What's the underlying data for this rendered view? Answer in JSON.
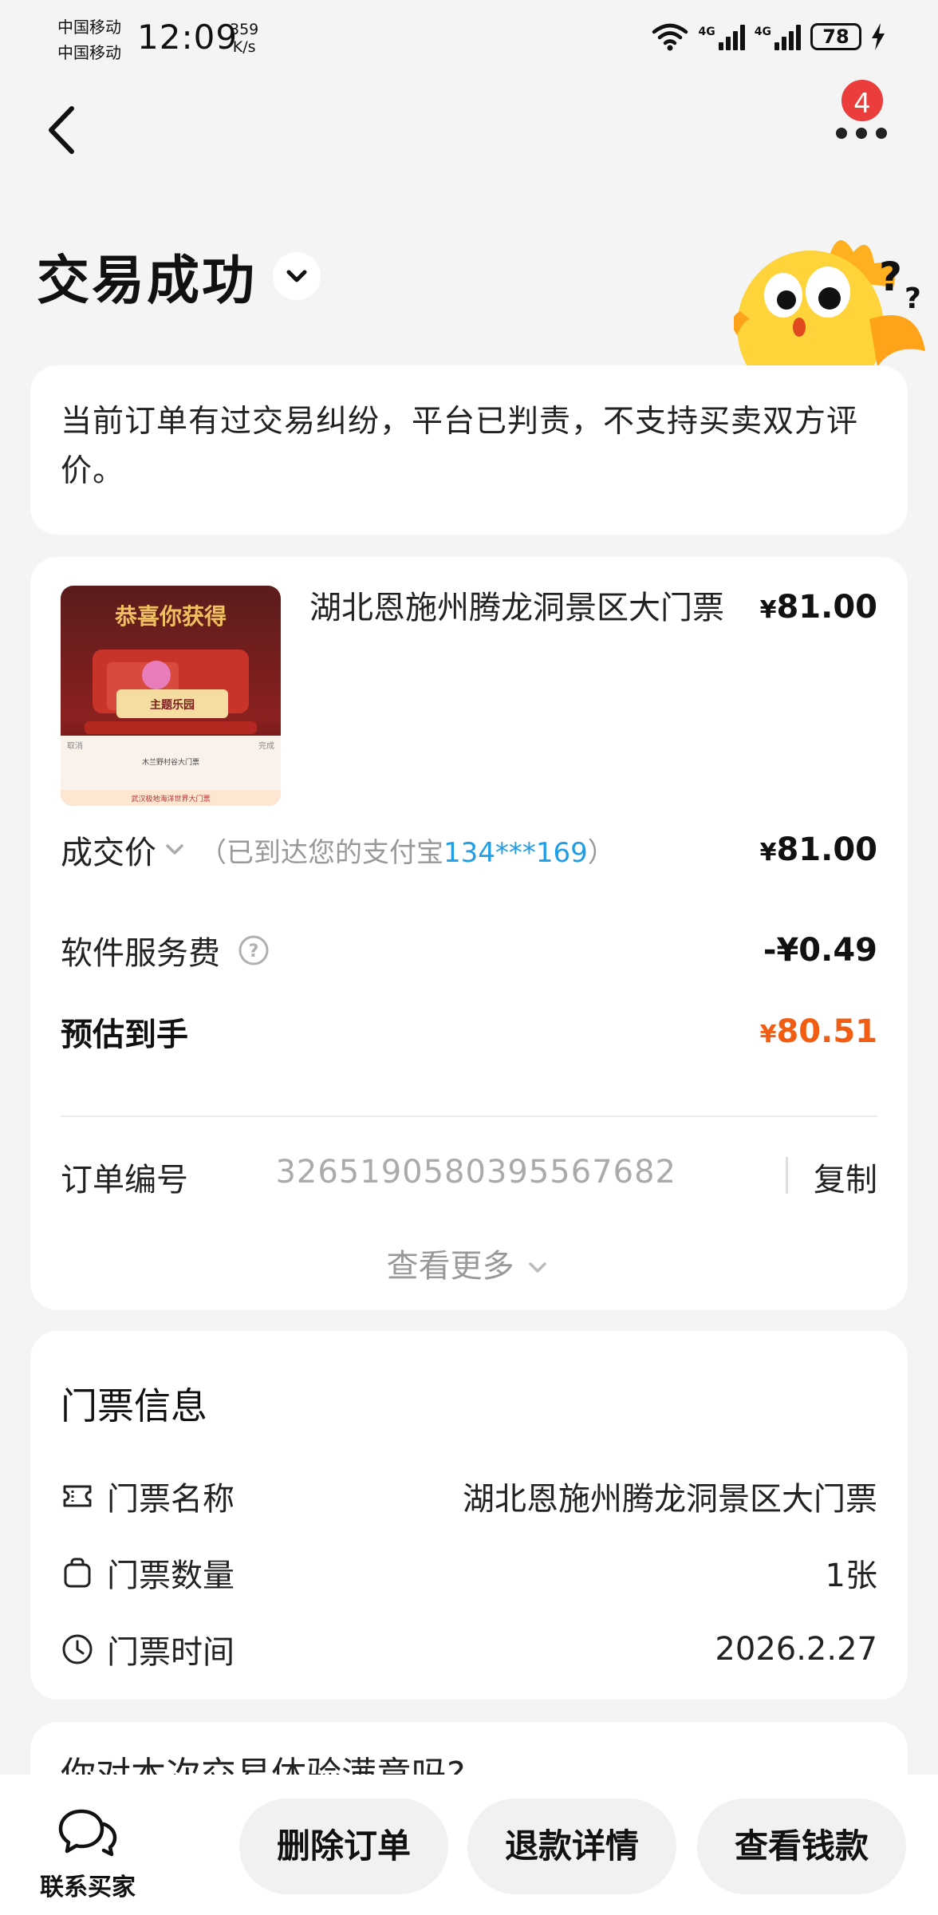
{
  "status_bar": {
    "carrier_1": "中国移动",
    "carrier_2": "中国移动",
    "time": "12:09",
    "speed_value": "359",
    "speed_unit": "K/s",
    "network_1": "4G",
    "network_2": "4G",
    "battery": "78"
  },
  "nav": {
    "badge_count": "4"
  },
  "header": {
    "title": "交易成功"
  },
  "notice": {
    "text": "当前订单有过交易纠纷，平台已判责，不支持买卖双方评价。"
  },
  "order": {
    "item_title": "湖北恩施州腾龙洞景区大门票",
    "item_price": "81.00",
    "currency": "¥",
    "deal_label": "成交价",
    "deal_hint_prefix": "（已到达您的支付宝",
    "deal_hint_account": "134***169",
    "deal_hint_suffix": "）",
    "deal_price": "81.00",
    "fee_label": "软件服务费",
    "fee_value": "-¥0.49",
    "estimate_label": "预估到手",
    "estimate_value": "80.51",
    "order_no_label": "订单编号",
    "order_no": "3265190580395567682",
    "copy_label": "复制",
    "more_label": "查看更多"
  },
  "thumbnail": {
    "banner": "恭喜你获得",
    "tag": "主题乐园",
    "cancel": "取消",
    "done": "完成",
    "line1": "木兰野村谷大门票",
    "line2": "武汉极地海洋世界大门票"
  },
  "ticket": {
    "section_title": "门票信息",
    "rows": [
      {
        "label": "门票名称",
        "value": "湖北恩施州腾龙洞景区大门票",
        "icon": "ticket-icon"
      },
      {
        "label": "门票数量",
        "value": "1张",
        "icon": "bag-icon"
      },
      {
        "label": "门票时间",
        "value": "2026.2.27",
        "icon": "clock-icon"
      }
    ]
  },
  "survey": {
    "title": "你对本次交易体验满意吗?"
  },
  "bottom_bar": {
    "contact_label": "联系买家",
    "buttons": [
      "删除订单",
      "退款详情",
      "查看钱款"
    ]
  },
  "colors": {
    "accent_orange": "#f15d13",
    "link_blue": "#1f9ee8",
    "badge_red": "#ec3d3d",
    "page_bg": "#f4f4f4"
  }
}
